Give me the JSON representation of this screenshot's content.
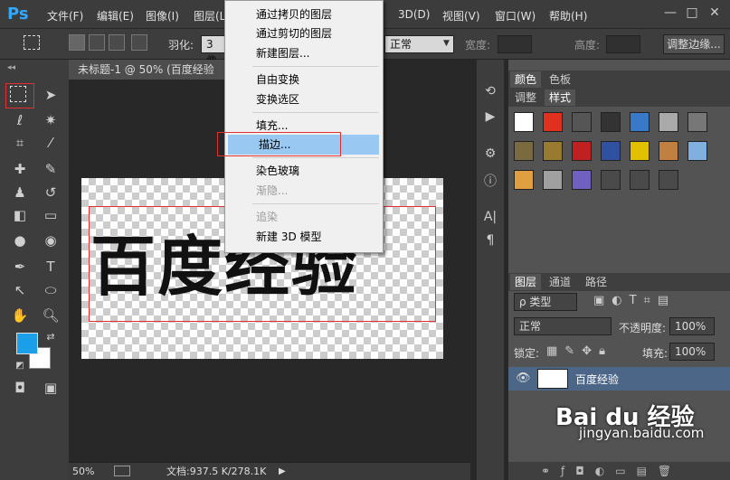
{
  "app": {
    "logo": "Ps"
  },
  "menubar": {
    "items": [
      "文件(F)",
      "编辑(E)",
      "图像(I)",
      "图层(L)",
      "3D(D)",
      "视图(V)",
      "窗口(W)",
      "帮助(H)"
    ],
    "window_buttons": [
      "—",
      "□",
      "✕"
    ]
  },
  "options": {
    "feather_label": "羽化:",
    "feather_value": "3 像",
    "style_value": "正常",
    "width_label": "宽度:",
    "height_label": "高度:",
    "refine_button": "调整边缘..."
  },
  "document": {
    "tab_title": "未标题-1 @ 50% (百度经验",
    "canvas_text": "百度经验",
    "zoom": "50%",
    "doc_info": "文档:937.5 K/278.1K"
  },
  "context_menu": {
    "items": [
      {
        "label": "通过拷贝的图层",
        "disabled": false,
        "highlighted": false
      },
      {
        "label": "通过剪切的图层",
        "disabled": false,
        "highlighted": false
      },
      {
        "label": "新建图层...",
        "disabled": false,
        "highlighted": false
      },
      {
        "label": "自由变换",
        "disabled": false,
        "highlighted": false
      },
      {
        "label": "变换选区",
        "disabled": false,
        "highlighted": false
      },
      {
        "label": "填充...",
        "disabled": false,
        "highlighted": false
      },
      {
        "label": "描边...",
        "disabled": false,
        "highlighted": true
      },
      {
        "label": "染色玻璃",
        "disabled": false,
        "highlighted": false
      },
      {
        "label": "渐隐...",
        "disabled": true,
        "highlighted": false
      },
      {
        "label": "追染",
        "disabled": true,
        "highlighted": false
      },
      {
        "label": "新建 3D 模型",
        "disabled": false,
        "highlighted": false
      }
    ]
  },
  "panels": {
    "color_tabs": [
      "颜色",
      "色板"
    ],
    "style_tabs": [
      "调整",
      "样式"
    ],
    "layer_tabs": [
      "图层",
      "通道",
      "路径"
    ],
    "layer_filter": "ρ 类型",
    "blend_mode": "正常",
    "opacity_label": "不透明度:",
    "opacity_value": "100%",
    "lock_label": "锁定:",
    "fill_label": "填充:",
    "fill_value": "100%",
    "layer_name": "百度经验"
  },
  "colors": {
    "foreground": "#1a9fe8",
    "background": "#ffffff",
    "highlight": "#99c9f2"
  },
  "watermark": {
    "brand": "Bai du 经验",
    "url": "jingyan.baidu.com"
  }
}
